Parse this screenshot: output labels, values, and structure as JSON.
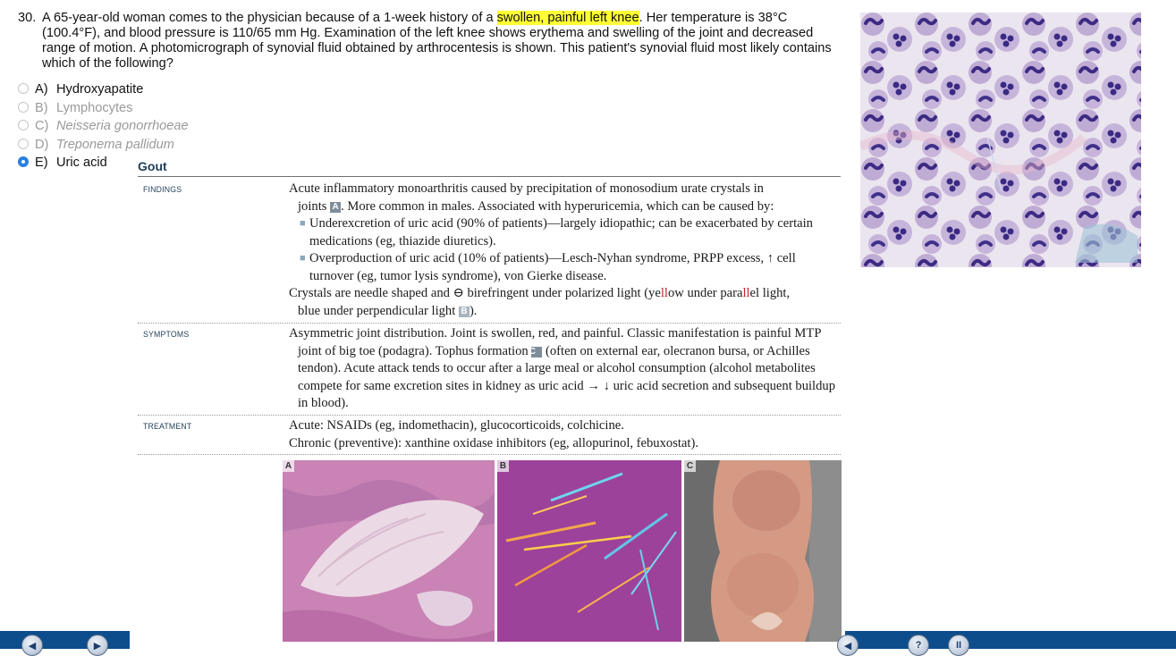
{
  "question": {
    "number": "30.",
    "text_before": "A 65-year-old woman comes to the physician because of a 1-week history of a ",
    "highlight": "swollen, painful left knee",
    "text_after": ". Her temperature is 38°C (100.4°F), and blood pressure is 110/65 mm Hg. Examination of the left knee shows erythema and swelling of the joint and decreased range of motion. A photomicrograph of synovial fluid obtained by arthrocentesis is shown. This patient's synovial fluid most likely contains which of the following?"
  },
  "choices": [
    {
      "letter": "A)",
      "text": "Hydroxyapatite",
      "state": "normal"
    },
    {
      "letter": "B)",
      "text": "Lymphocytes",
      "state": "struck"
    },
    {
      "letter": "C)",
      "text": "Neisseria gonorrhoeae",
      "state": "struck"
    },
    {
      "letter": "D)",
      "text": "Treponema pallidum",
      "state": "struck"
    },
    {
      "letter": "E)",
      "text": "Uric acid",
      "state": "selected"
    }
  ],
  "explanation": {
    "title": "Gout",
    "findings": {
      "label": "FINDINGS",
      "line1": "Acute inflammatory monoarthritis caused by precipitation of monosodium urate crystals in",
      "line2a": "joints ",
      "ref_a": "A",
      "line2b": ". More common in males. Associated with hyperuricemia, which can be caused by:",
      "bullet1": "Underexcretion of uric acid (90% of patients)—largely idiopathic; can be exacerbated by certain medications (eg, thiazide diuretics).",
      "bullet2": "Overproduction of uric acid (10% of patients)—Lesch-Nyhan syndrome, PRPP excess, ↑ cell turnover (eg, tumor lysis syndrome), von Gierke disease.",
      "crystal_a": "Crystals are needle shaped and ⊖ birefringent under polarized light (ye",
      "crystal_red1": "ll",
      "crystal_b": "ow under para",
      "crystal_red2": "ll",
      "crystal_c": "el light,",
      "crystal_d": "blue under perpendicular light ",
      "ref_b": "B",
      "crystal_e": ")."
    },
    "symptoms": {
      "label": "SYMPTOMS",
      "text_a": "Asymmetric joint distribution. Joint is swollen, red, and painful. Classic manifestation is painful MTP joint of big toe (podagra). Tophus formation ",
      "ref_c": "C",
      "text_b": " (often on external ear, olecranon bursa, or Achilles tendon). Acute attack tends to occur after a large meal or alcohol consumption (alcohol metabolites compete for same excretion sites in kidney as uric acid → ↓ uric acid secretion and subsequent buildup in blood)."
    },
    "treatment": {
      "label": "TREATMENT",
      "line1": "Acute: NSAIDs (eg, indomethacin), glucocorticoids, colchicine.",
      "line2": "Chronic (preventive): xanthine oxidase inhibitors (eg, allopurinol, febuxostat)."
    },
    "image_labels": [
      "A",
      "B",
      "C"
    ]
  },
  "nav": {
    "prev_icon": "arrow-left-icon",
    "next_icon": "arrow-right-icon",
    "help_icon": "question-icon",
    "pause_icon": "pause-icon",
    "prev_glyph": "◀",
    "next_glyph": "▶",
    "help_glyph": "?",
    "pause_glyph": "II",
    "bar_color": "#0d4d8c"
  }
}
